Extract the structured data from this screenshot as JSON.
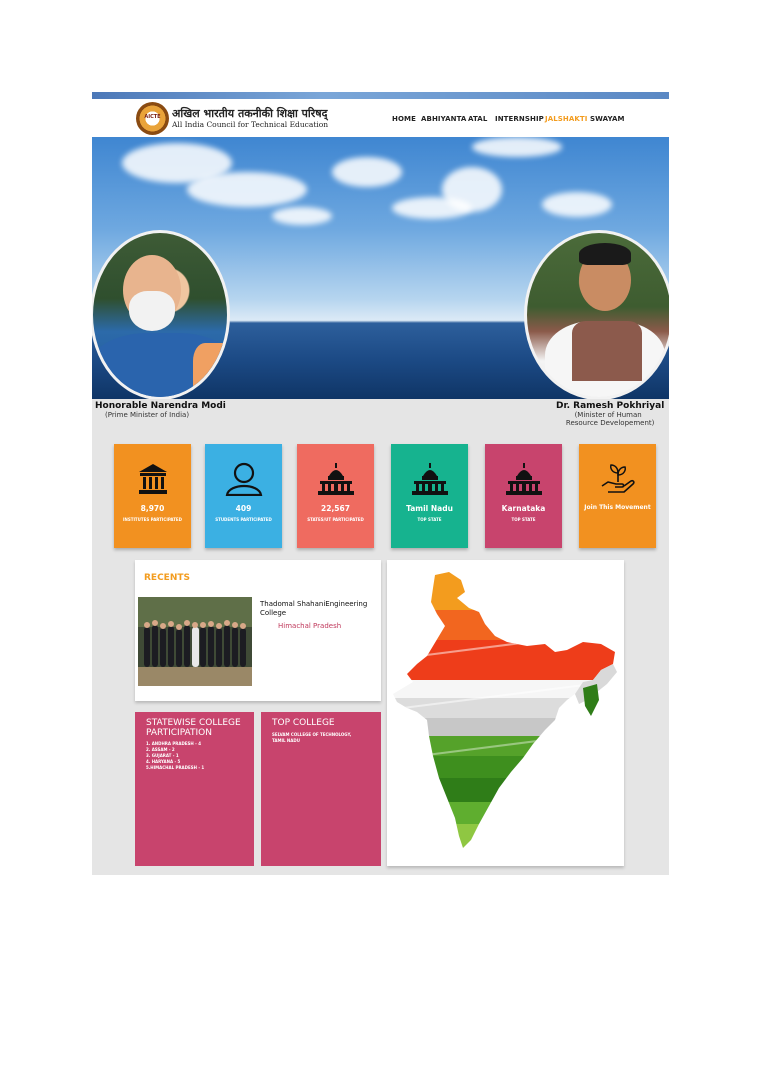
{
  "header": {
    "org_hindi": "अखिल भारतीय तकनीकी शिक्षा परिषद्",
    "org_english": "All India Council for Technical Education",
    "logo_text": "AICTE",
    "nav": [
      "HOME",
      "ABHIYANTA",
      "ATAL",
      "INTERNSHIP",
      "JALSHAKTI",
      "SWAYAM"
    ],
    "active_nav": "JALSHAKTI"
  },
  "hero": {
    "left_person": {
      "name": "Honorable Narendra Modi",
      "role": "(Prime Minister of India)"
    },
    "right_person": {
      "name": "Dr. Ramesh Pokhriyal",
      "role_lines": [
        "(Minister of Human",
        "Resource Developement)"
      ]
    }
  },
  "tiles": [
    {
      "value": "8,970",
      "label": "INSTITUTES PARTICIPATED",
      "color": "#f29120",
      "icon": "institution-icon"
    },
    {
      "value": "409",
      "label": "STUDENTS PARTICIPATED",
      "color": "#3bb0e3",
      "icon": "user-icon"
    },
    {
      "value": "22,567",
      "label": "STATES/UT PARTICIPATED",
      "color": "#ef6b60",
      "icon": "capitol-icon"
    },
    {
      "value": "Tamil Nadu",
      "label": "TOP STATE",
      "color": "#16b38f",
      "icon": "capitol-icon"
    },
    {
      "value": "Karnataka",
      "label": "TOP STATE",
      "color": "#c8446d",
      "icon": "capitol-icon"
    },
    {
      "value": "Join This Movement",
      "label": "",
      "color": "#f29120",
      "icon": "plant-hand-icon"
    }
  ],
  "recents": {
    "title": "RECENTS",
    "college": "Thadomal ShahaniEngineering College",
    "state": "Himachal Pradesh"
  },
  "statewise": {
    "title_lines": [
      "STATEWISE COLLEGE",
      "PARTICIPATION"
    ],
    "items": [
      "1. ANDHRA PRADESH - 4",
      "2. ASSAM - 2",
      "3. GUJARAT - 1",
      "4. HARYANA - 5",
      "5.HIMACHAL PRADESH - 1"
    ]
  },
  "top_college": {
    "title": "TOP COLLEGE",
    "name_lines": [
      "SELVAM COLLEGE OF TECHNOLOGY,",
      "TAMIL NADU"
    ]
  },
  "colors": {
    "accent_orange": "#f39c1e",
    "pink": "#c8446d"
  }
}
